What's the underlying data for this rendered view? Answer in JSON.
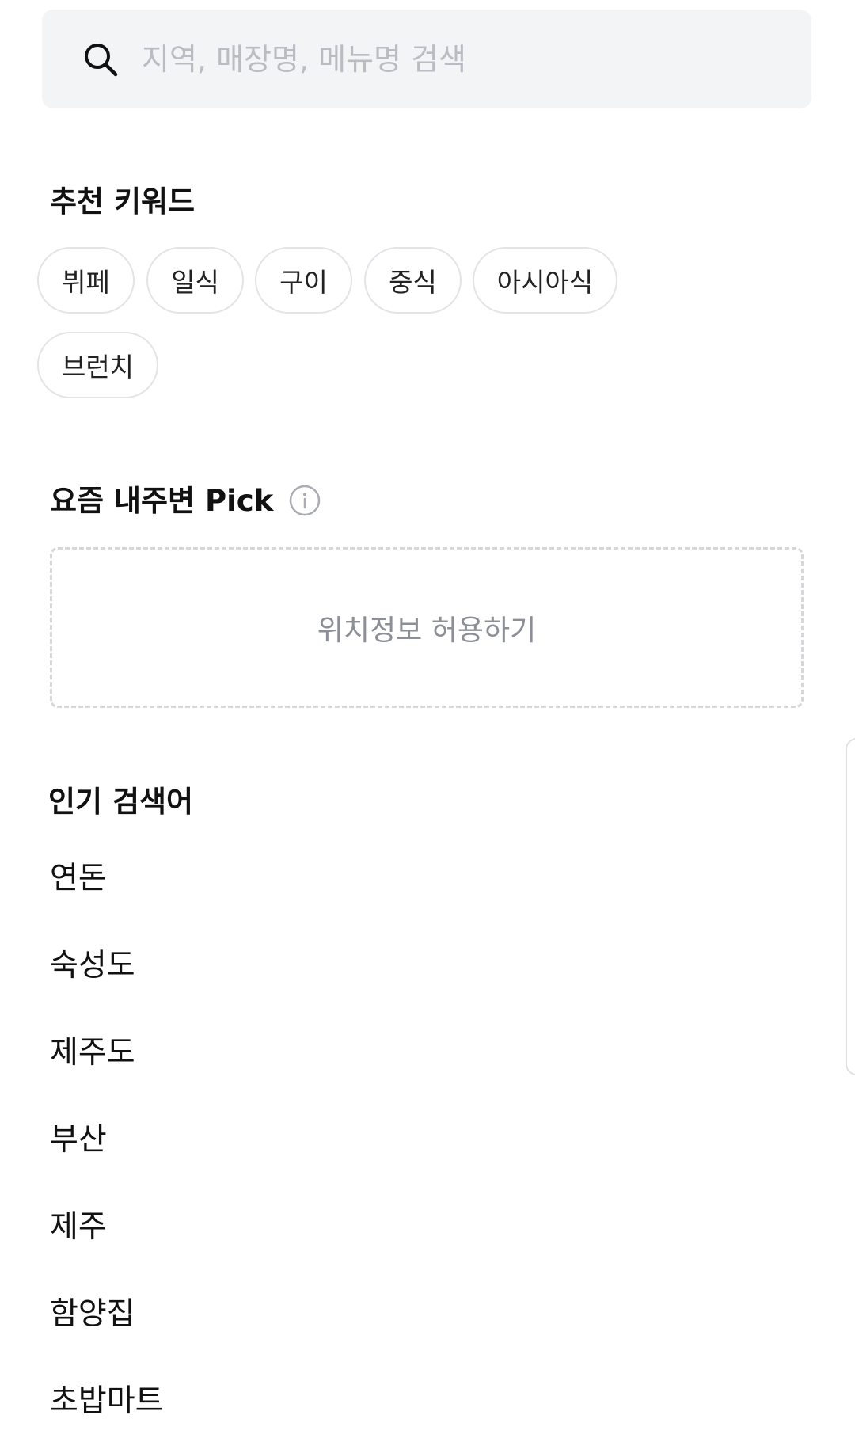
{
  "search": {
    "placeholder": "지역, 매장명, 메뉴명 검색",
    "icon": "search-icon"
  },
  "recommended": {
    "title": "추천 키워드",
    "keywords": [
      "뷔페",
      "일식",
      "구이",
      "중식",
      "아시아식",
      "브런치"
    ]
  },
  "nearby_pick": {
    "title": "요즘 내주변 Pick",
    "info_icon": "info-icon",
    "location_label": "위치정보 허용하기"
  },
  "popular": {
    "title": "인기 검색어",
    "items": [
      "연돈",
      "숙성도",
      "제주도",
      "부산",
      "제주",
      "함양집",
      "초밥마트"
    ]
  },
  "colors": {
    "search_bg": "#f3f4f6",
    "placeholder": "#b9bcc3",
    "chip_border": "#e3e4e8",
    "dashed_border": "#d6d7db",
    "muted_text": "#8c8f96"
  }
}
